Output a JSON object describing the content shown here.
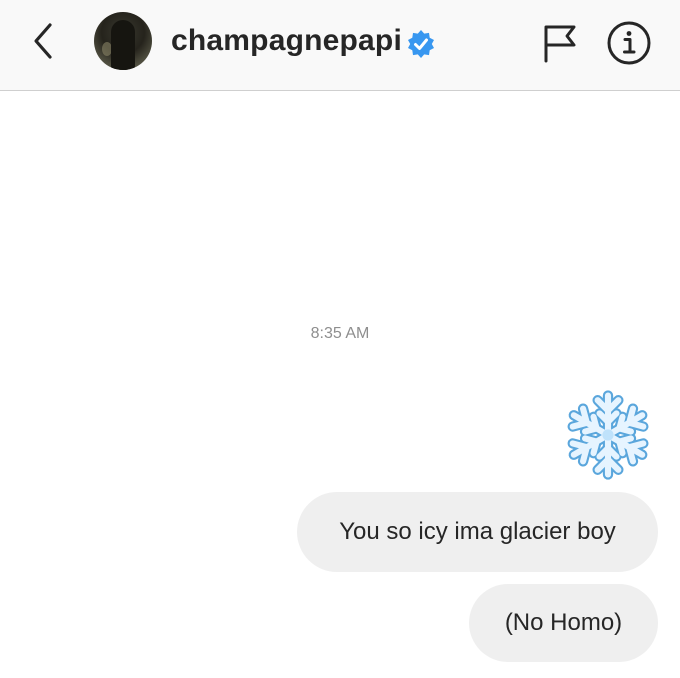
{
  "header": {
    "username": "champagnepapi",
    "verified": true,
    "icons": [
      "back-chevron-icon",
      "avatar",
      "verified-badge-icon",
      "flag-icon",
      "info-icon"
    ]
  },
  "thread": {
    "timestamp": "8:35 AM",
    "messages": [
      {
        "type": "emoji",
        "emoji": "snowflake",
        "sender": "me"
      },
      {
        "type": "text",
        "text": "You so icy ima glacier boy",
        "sender": "me"
      },
      {
        "type": "text",
        "text": "(No Homo)",
        "sender": "me"
      }
    ]
  },
  "colors": {
    "header_bg": "#f9f9f9",
    "bubble_bg": "#efefef",
    "verified_blue": "#3897f0",
    "text": "#262626",
    "muted": "#8e8e8e"
  }
}
